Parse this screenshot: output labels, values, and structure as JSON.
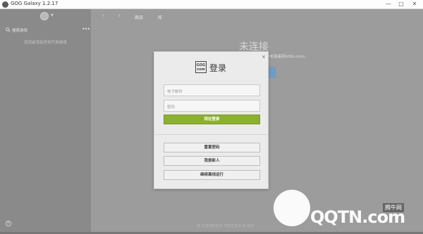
{
  "window": {
    "title": "GOG Galaxy 1.2.17",
    "min_label": "—",
    "max_label": "□",
    "close_label": "✕"
  },
  "sidebar": {
    "search_placeholder": "搜索游戏",
    "more_label": "•••",
    "empty_message": "您目前没有任何可用游戏",
    "add_label": "+"
  },
  "nav": {
    "back": "‹",
    "forward": "›",
    "tabs": [
      "商店",
      "库"
    ]
  },
  "main": {
    "heading": "未连接",
    "subtext": "中未连接到GOG.com。",
    "footer": "离 已连接的好友   可能正在玩   和   我的"
  },
  "dialog": {
    "close": "×",
    "logo_text": "GOG com",
    "title": "登录",
    "email_placeholder": "电子邮件",
    "password_placeholder": "密码",
    "login_button": "现在登录",
    "reset_password": "重置密码",
    "new_user": "我是新人",
    "offline": "继续离线运行"
  },
  "watermark": {
    "logo_text": "QQTN.com",
    "badge": "腾牛网"
  },
  "colors": {
    "accent_green": "#8cb030",
    "sidebar_bg": "#8a8a8a",
    "main_bg": "#9c9c9c"
  }
}
